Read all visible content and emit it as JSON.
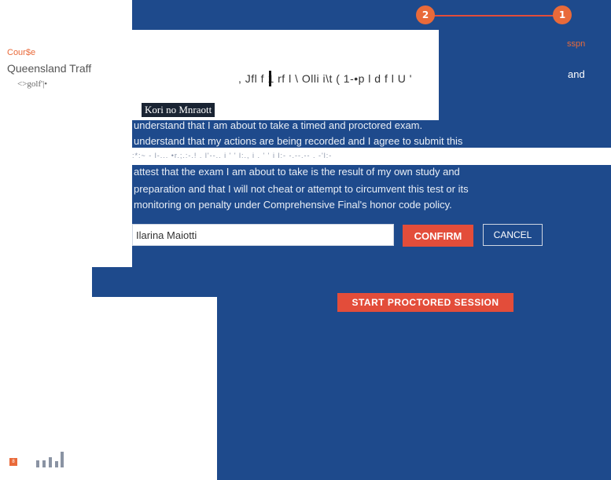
{
  "sidebar": {
    "course_label": "Cour$e",
    "course_name": "Queensland Traff",
    "course_sub": "<>golf'|•"
  },
  "stepper": {
    "step_left": "2",
    "step_right": "1",
    "accent": "#e34d3a"
  },
  "header": {
    "garbled_title": ", Jfl f 1  rf l \\ Olli i\\t ( 1-•p l d f l U '",
    "right_label": "sspn",
    "and_text": "and"
  },
  "attestation": {
    "name_label": "Kori no Mnraott",
    "lines": [
      "understand that I am about to take a timed and proctored exam.",
      "understand that my actions are being recorded and I agree to submit this",
      "attest that the exam I am about to take is the result of my own study and",
      "preparation and that I will not cheat or attempt to circumvent this test or its",
      "monitoring on penalty under Comprehensive Final's  honor code policy."
    ],
    "garbled_line": ":*:~ - l-... •r.;.:-.! .   l'--..                                         i ' ' l:., i . ' ' i l:-  -.--.-- . -'l:-",
    "signature_value": "Ilarina Maiotti",
    "confirm_label": "CONFIRM",
    "cancel_label": "CANCEL"
  },
  "actions": {
    "start_label": "START PROCTORED SESSION"
  },
  "footer": {
    "badge": "8"
  },
  "colors": {
    "panel": "#1e4a8c",
    "accent": "#e34d3a",
    "orange": "#e96a3a"
  }
}
